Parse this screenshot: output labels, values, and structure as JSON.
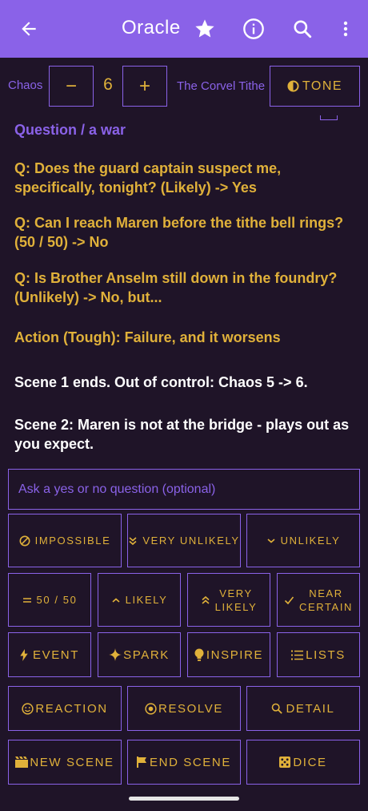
{
  "app_bar": {
    "title": "Oracle",
    "icons": [
      "back-arrow-icon",
      "star-icon",
      "info-icon",
      "search-icon",
      "more-vert-icon"
    ]
  },
  "chaos": {
    "label": "Chaos",
    "value": "6",
    "decrement_label": "−",
    "increment_label": "+",
    "thread_title": "The Corvel Tithe",
    "tone_label": "TONE"
  },
  "log": {
    "entries": [
      {
        "text": "Question / a war",
        "style": "purple"
      },
      {
        "text": "Q: Does the guard captain suspect me, specifically, tonight? (Likely) -> Yes",
        "style": "gold"
      },
      {
        "text": "Q: Can I reach Maren before the tithe bell rings? (50 / 50) -> No",
        "style": "gold"
      },
      {
        "text": "Q: Is Brother Anselm still down in the foundry? (Unlikely) -> No, but...",
        "style": "gold"
      },
      {
        "text": "Action (Tough): Failure, and it worsens",
        "style": "gold"
      },
      {
        "text": "Scene 1 ends. Out of control: Chaos 5 -> 6.",
        "style": "white"
      },
      {
        "text": "Scene 2: Maren is not at the bridge - plays out as you expect.",
        "style": "white"
      }
    ]
  },
  "question_input": {
    "placeholder": "Ask a yes or no question (optional)",
    "value": ""
  },
  "likelihood_buttons": {
    "impossible": "IMPOSSIBLE",
    "very_unlikely": "VERY UNLIKELY",
    "unlikely": "UNLIKELY",
    "fifty_fifty": "50 / 50",
    "likely": "LIKELY",
    "very_likely_1": "VERY",
    "very_likely_2": "LIKELY",
    "near_certain_1": "NEAR",
    "near_certain_2": "CERTAIN"
  },
  "tool_buttons": {
    "event": "EVENT",
    "spark": "SPARK",
    "inspire": "INSPIRE",
    "lists": "LISTS",
    "reaction": "REACTION",
    "resolve": "RESOLVE",
    "detail": "DETAIL",
    "new_scene": "NEW SCENE",
    "end_scene": "END SCENE",
    "dice": "DICE"
  },
  "colors": {
    "app_bar": "#8a62e8",
    "background": "#1f1428",
    "accent_gold": "#e0b13a",
    "outline": "#8a62e8"
  }
}
